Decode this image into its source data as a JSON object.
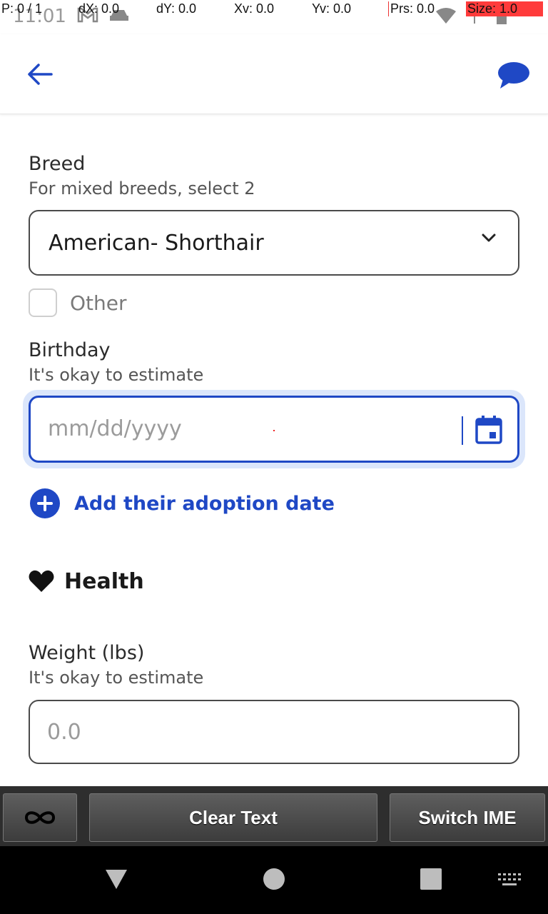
{
  "status_bar": {
    "time": "11:01"
  },
  "pointer_overlay": {
    "p": "P: 0 / 1",
    "dx": "dX: 0.0",
    "dy": "dY: 0.0",
    "xv": "Xv: 0.0",
    "yv": "Yv: 0.0",
    "prs": "Prs: 0.0",
    "size": "Size: 1.0"
  },
  "app_bar": {
    "back_icon": "arrow-left-icon",
    "chat_icon": "chat-bubble-icon"
  },
  "form": {
    "breed": {
      "label": "Breed",
      "hint": "For mixed breeds, select 2",
      "selected_value": "American- Shorthair"
    },
    "other_checkbox": {
      "label": "Other",
      "checked": false
    },
    "birthday": {
      "label": "Birthday",
      "hint": "It's okay to estimate",
      "placeholder": "mm/dd/yyyy"
    },
    "adoption": {
      "label": "Add their adoption date"
    },
    "health_section": {
      "title": "Health",
      "icon": "heart-icon"
    },
    "weight": {
      "label": "Weight (lbs)",
      "hint": "It's okay to estimate",
      "placeholder": "0.0"
    }
  },
  "ime_toolbar": {
    "clear_label": "Clear Text",
    "switch_label": "Switch IME"
  },
  "colors": {
    "accent": "#1f48c5",
    "focus_ring": "#dbe6fb",
    "ime_bar": "#2e2e2e",
    "nav_bar": "#000000"
  }
}
